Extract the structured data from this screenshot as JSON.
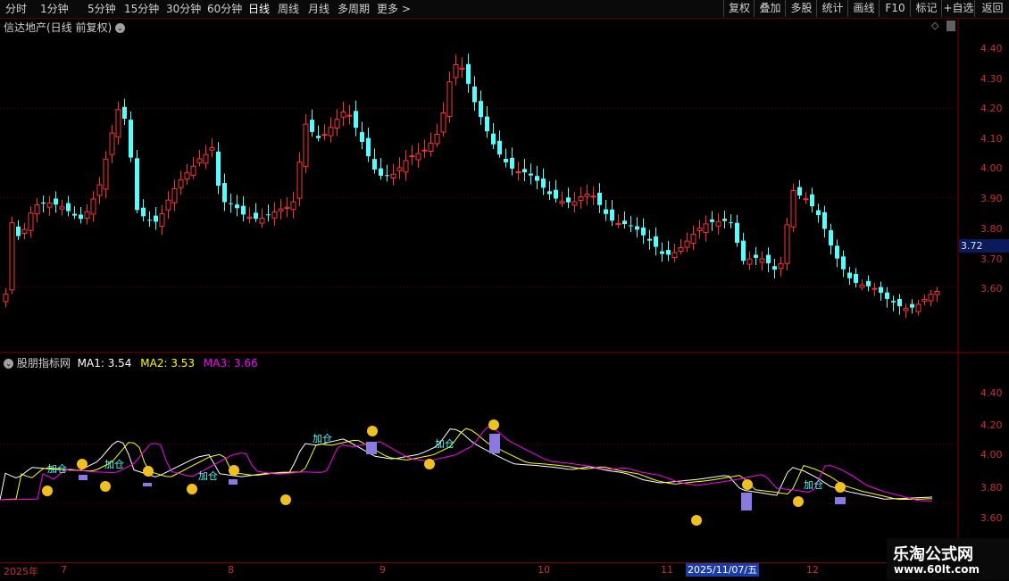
{
  "toolbar": {
    "periods": [
      "分时",
      "1分钟",
      "5分钟",
      "15分钟",
      "30分钟",
      "60分钟",
      "日线",
      "周线",
      "月线",
      "多周期",
      "更多 >"
    ],
    "tools": [
      "复权",
      "叠加",
      "多股",
      "统计",
      "画线",
      "F10",
      "标记",
      "+自选",
      "返回"
    ]
  },
  "main_panel": {
    "title": "信达地产(日线 前复权)",
    "current_price": "3.72",
    "y_ticks": [
      "4.40",
      "4.30",
      "4.20",
      "4.10",
      "4.00",
      "3.90",
      "3.80",
      "3.70",
      "3.60"
    ]
  },
  "indicator_panel": {
    "name": "股朋指标网",
    "ma1_label": "MA1: 3.54",
    "ma2_label": "MA2: 3.53",
    "ma3_label": "MA3: 3.66",
    "signal_text": "加仓",
    "y_ticks": [
      "4.40",
      "4.20",
      "4.00",
      "3.80",
      "3.60"
    ]
  },
  "x_axis": {
    "labels": [
      "2025年",
      "7",
      "8",
      "9",
      "10",
      "11",
      "12"
    ],
    "cursor_date": "2025/11/07/五"
  },
  "watermark": {
    "name": "乐淘公式网",
    "url": "www.60lt.com"
  },
  "colors": {
    "up": "#ff3232",
    "down": "#54ffff",
    "ma1": "#ffffff",
    "ma2": "#ffff00",
    "ma3": "#ff00ff",
    "axis": "#c83232"
  }
}
